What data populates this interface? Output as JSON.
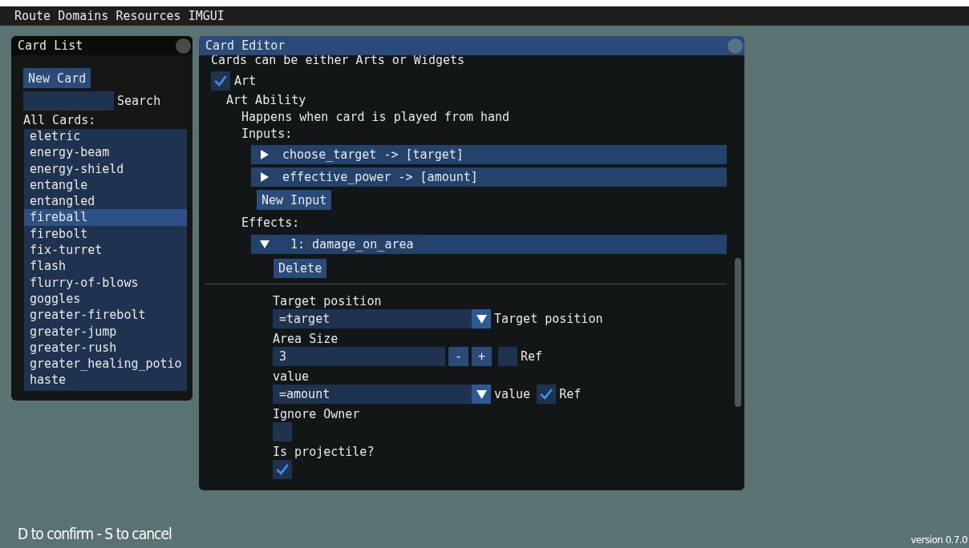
{
  "menu_bar": {
    "items": [
      "Route",
      "Domains",
      "Resources",
      "IMGUI"
    ]
  },
  "card_list": {
    "title": "Card List",
    "new_card_button": "New Card",
    "search": {
      "label": "Search"
    },
    "all_cards_label": "All Cards:",
    "cards": [
      {
        "label": "eletric",
        "selected": false
      },
      {
        "label": "energy-beam",
        "selected": false
      },
      {
        "label": "energy-shield",
        "selected": false
      },
      {
        "label": "entangle",
        "selected": false
      },
      {
        "label": "entangled",
        "selected": false
      },
      {
        "label": "fireball",
        "selected": true
      },
      {
        "label": "firebolt",
        "selected": false
      },
      {
        "label": "fix-turret",
        "selected": false
      },
      {
        "label": "flash",
        "selected": false
      },
      {
        "label": "flurry-of-blows",
        "selected": false
      },
      {
        "label": "goggles",
        "selected": false
      },
      {
        "label": "greater-firebolt",
        "selected": false
      },
      {
        "label": "greater-jump",
        "selected": false
      },
      {
        "label": "greater-rush",
        "selected": false
      },
      {
        "label": "greater_healing_potio",
        "selected": false
      },
      {
        "label": "haste",
        "selected": false
      }
    ]
  },
  "card_editor": {
    "title": "Card Editor",
    "intro": "Cards can be either Arts or Widgets",
    "art": {
      "label": "Art",
      "checked": true
    },
    "art_ability": "Art Ability",
    "description": "Happens when card is played from hand",
    "inputs_label": "Inputs:",
    "inputs": [
      {
        "label": "choose_target -> [target]",
        "expanded": false
      },
      {
        "label": "effective_power -> [amount]",
        "expanded": false
      }
    ],
    "new_input_button": "New Input",
    "effects_label": "Effects:",
    "effects": [
      {
        "index": "1:",
        "name": "damage_on_area",
        "expanded": true
      }
    ],
    "delete_button": "Delete",
    "fields": [
      {
        "kind": "combo",
        "label": "Target position",
        "value": "=target",
        "side_label": "Target position"
      },
      {
        "kind": "number",
        "label": "Area Size",
        "value": "3",
        "minus": "-",
        "plus": "+",
        "ref": {
          "label": "Ref",
          "checked": false
        }
      },
      {
        "kind": "combo",
        "label": "value",
        "value": "=amount",
        "side_label": "value",
        "ref": {
          "label": "Ref",
          "checked": true
        }
      },
      {
        "kind": "checkbox",
        "label": "Ignore Owner",
        "checked": false
      },
      {
        "kind": "checkbox",
        "label": "Is projectile?",
        "checked": true
      }
    ]
  },
  "hint": "D to confirm - S to cancel",
  "version": "version 0.7.0"
}
